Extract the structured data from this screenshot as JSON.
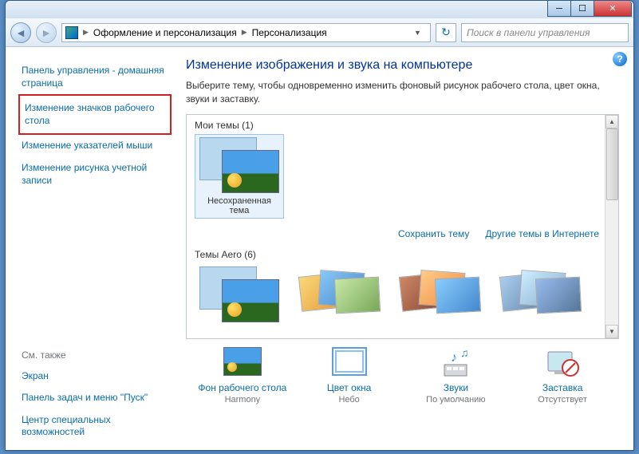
{
  "titlebar": {
    "min": "__",
    "max": "☐",
    "close": "✕"
  },
  "nav": {
    "back": "◄",
    "fwd": "►",
    "crumb1": "Оформление и персонализация",
    "crumb2": "Персонализация",
    "sep": "▶",
    "refresh": "↻",
    "search_placeholder": "Поиск в панели управления"
  },
  "sidebar": {
    "home": "Панель управления - домашняя страница",
    "link1": "Изменение значков рабочего стола",
    "link2": "Изменение указателей мыши",
    "link3": "Изменение рисунка учетной записи",
    "see_also": "См. также",
    "sa1": "Экран",
    "sa2": "Панель задач и меню \"Пуск\"",
    "sa3": "Центр специальных возможностей"
  },
  "main": {
    "help": "?",
    "title": "Изменение изображения и звука на компьютере",
    "desc": "Выберите тему, чтобы одновременно изменить фоновый рисунок рабочего стола, цвет окна, звуки и заставку.",
    "my_themes": "Мои темы (1)",
    "unsaved": "Несохраненная тема",
    "save_theme": "Сохранить тему",
    "more_themes": "Другие темы в Интернете",
    "aero": "Темы Aero (6)"
  },
  "bottom": {
    "bg": {
      "label": "Фон рабочего стола",
      "sub": "Harmony"
    },
    "color": {
      "label": "Цвет окна",
      "sub": "Небо"
    },
    "sound": {
      "label": "Звуки",
      "sub": "По умолчанию"
    },
    "saver": {
      "label": "Заставка",
      "sub": "Отсутствует"
    }
  }
}
